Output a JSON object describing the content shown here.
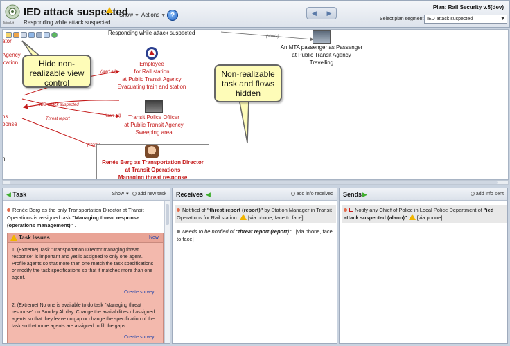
{
  "header": {
    "logo_caption": "Mind-it",
    "title": "IED attack suspected",
    "subtitle": "Responding while attack suspected",
    "show_menu": "Show",
    "actions_menu": "Actions",
    "help": "?",
    "plan": "Plan: Rail Security v.5(dev)",
    "segment_label": "Select plan segment:",
    "segment_value": "IED attack suspected"
  },
  "diagram": {
    "top_label": "Responding while attack suspected",
    "starts_label_1": "(starts)",
    "mta_node": [
      "An MTA passenger as Passenger",
      "at Public Transit Agency",
      "Travelling"
    ],
    "employee_node": [
      "Employee",
      "for Rail station",
      "at Public Transit Agency",
      "Evacuating train and station"
    ],
    "police_node": [
      "Transit Police Officer",
      "at Public Transit Agency",
      "Sweeping area"
    ],
    "renee_node": [
      "Renée Berg as Transportation Director",
      "at Transit Operations",
      "Managing threat response"
    ],
    "edge_start_all_1": "(start all)",
    "edge_start_all_2": "(start all)",
    "edge_starts_2": "(starts)",
    "edge_ied": "IED attack suspected",
    "edge_threat": "Threat report",
    "left_cut": [
      "ator",
      "Agency",
      "ication",
      "ns",
      "ponse",
      "n"
    ],
    "callout_left": [
      "Hide non-",
      "realizable view",
      "control"
    ],
    "callout_right": [
      "Non-realizable",
      "task and flows",
      "hidden"
    ]
  },
  "task_panel": {
    "title": "Task",
    "show": "Show",
    "add_task": "add new task",
    "description_1": "Renée Berg as the only Transportation Director at Transit",
    "description_2": "Operations is assigned task ",
    "description_bold": "\"Managing threat response (operations management)\"",
    "issues": {
      "title": "Task Issues",
      "new": "New",
      "issue1": "1. (Extreme) Task \"Transportation Director managing threat response\" is important and yet is assigned to only one agent. Profile agents so that more than one match the task specifications or modify the task specifications so that it matches more than one agent.",
      "issue2": "2. (Extreme) No one is available to do task \"Managing threat response\" on Sunday All day. Change the availabilities of assigned agents so that they leave no gap or change the specification of the task so that more agents are assigned to fill the gaps.",
      "create_survey": "Create survey"
    }
  },
  "receives_panel": {
    "title": "Receives",
    "add_info": "add info received",
    "item1_a": "Notified of ",
    "item1_bold": "\"threat report (report)\"",
    "item1_b": " by Station Manager in Transit Operations for Rail station.",
    "item1_via": "[via phone, face to face]",
    "item2_a": "Needs to be notified of ",
    "item2_bold": "\"threat report (report)\"",
    "item2_via": "[via phone, face to face]"
  },
  "sends_panel": {
    "title": "Sends",
    "add_info": "add info sent",
    "item1_a": "Notify any Chief of Police in Local Police Department of ",
    "item1_bold": "\"ied attack suspected (alarm)\"",
    "item1_via": "[via phone]"
  },
  "colors": {
    "accent_red": "#c41a1a",
    "callout_fill": "#fefcb8",
    "issues_fill": "#f3b9ad",
    "arrow_green": "#3fae2e"
  }
}
